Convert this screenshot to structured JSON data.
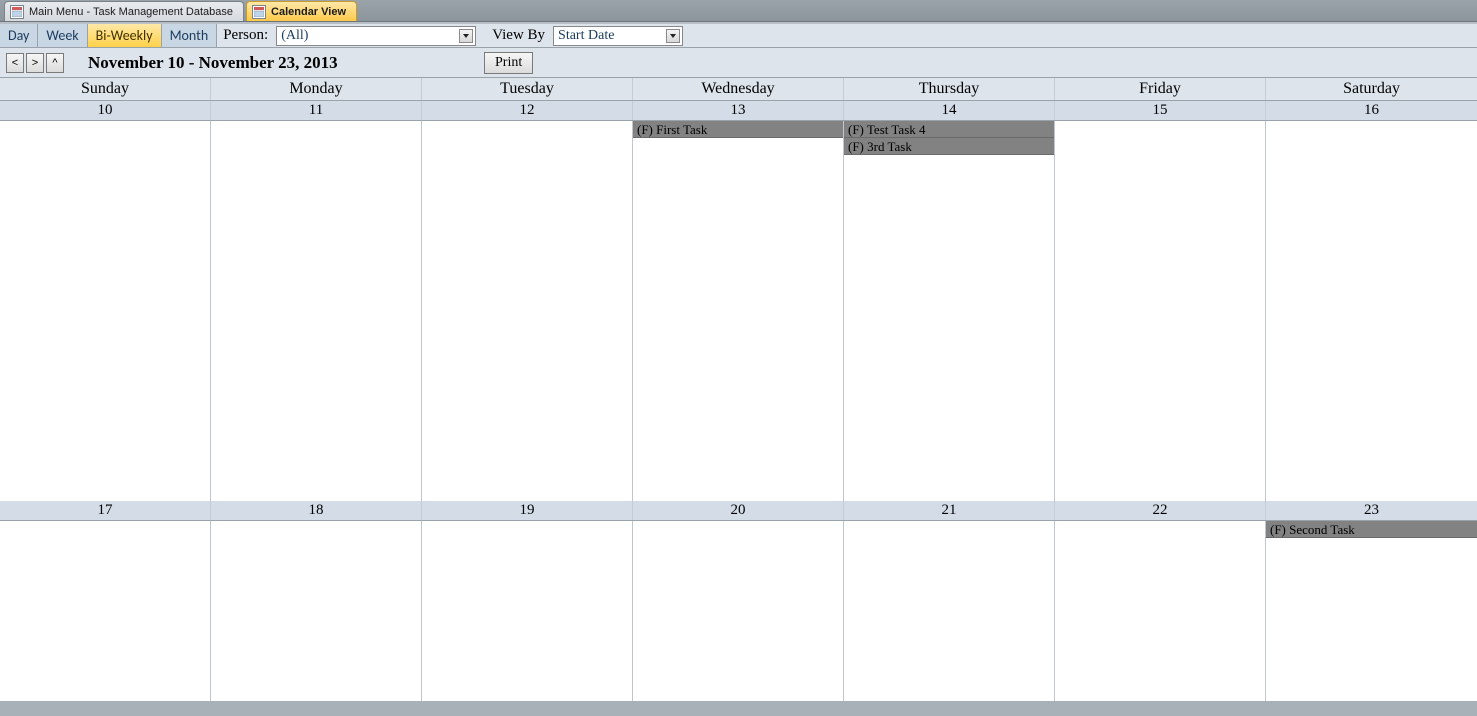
{
  "tabs": [
    {
      "label": "Main Menu - Task Management Database",
      "active": false
    },
    {
      "label": "Calendar View",
      "active": true
    }
  ],
  "viewbar": {
    "modes": {
      "day": "Day",
      "week": "Week",
      "biweekly": "Bi-Weekly",
      "month": "Month"
    },
    "active_mode": "biweekly",
    "person_label": "Person:",
    "person_value": "(All)",
    "viewby_label": "View By",
    "viewby_value": "Start Date"
  },
  "titlebar": {
    "nav_prev": "<",
    "nav_next": ">",
    "nav_up": "^",
    "range": "November 10 - November 23, 2013",
    "print": "Print"
  },
  "days_of_week": [
    "Sunday",
    "Monday",
    "Tuesday",
    "Wednesday",
    "Thursday",
    "Friday",
    "Saturday"
  ],
  "weeks": [
    {
      "dates": [
        "10",
        "11",
        "12",
        "13",
        "14",
        "15",
        "16"
      ],
      "events": {
        "3": [
          "(F) First Task"
        ],
        "4": [
          "(F) Test Task 4",
          "(F) 3rd Task"
        ]
      }
    },
    {
      "dates": [
        "17",
        "18",
        "19",
        "20",
        "21",
        "22",
        "23"
      ],
      "events": {
        "6": [
          "(F) Second Task"
        ]
      }
    }
  ]
}
